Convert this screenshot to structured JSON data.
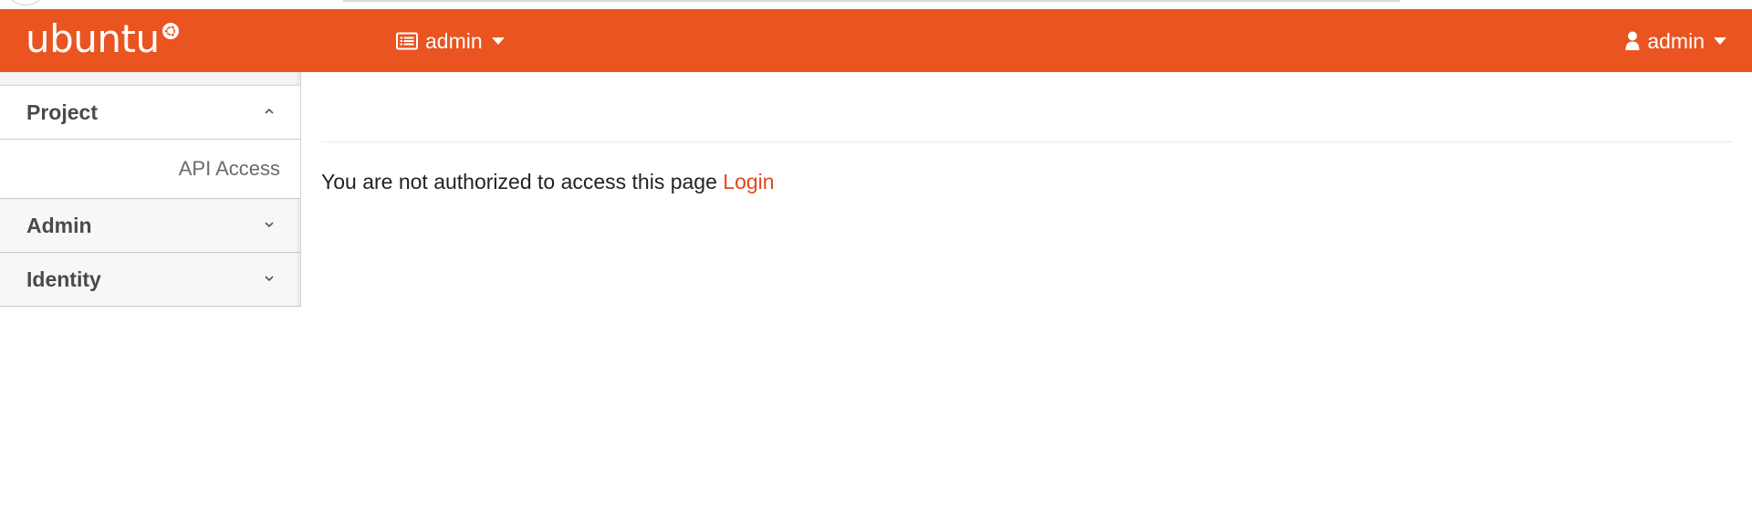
{
  "header": {
    "brand": "ubuntu",
    "brand_logo_icon": "circle-of-friends-icon",
    "project_picker": {
      "icon": "project-list-icon",
      "label": "admin"
    },
    "user_menu": {
      "icon": "user-icon",
      "label": "admin"
    },
    "colors": {
      "accent": "#e95420",
      "text": "#ffffff"
    }
  },
  "sidebar": {
    "panels": [
      {
        "label": "Project",
        "expanded": true,
        "items": [
          {
            "label": "API Access"
          }
        ]
      },
      {
        "label": "Admin",
        "expanded": false
      },
      {
        "label": "Identity",
        "expanded": false
      }
    ]
  },
  "main": {
    "message": "You are not authorized to access this page",
    "login_link": "Login",
    "link_color": "#e2461a"
  }
}
